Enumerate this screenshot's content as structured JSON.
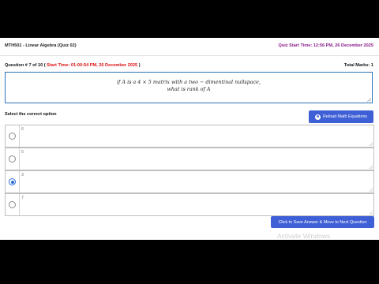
{
  "header": {
    "course": "MTH501 - Linear Algebra (Quiz 02)",
    "quiz_start": "Quiz Start Time: 12:56 PM, 26 December 2025"
  },
  "question": {
    "number_prefix": "Question # 7 of 10 (",
    "start_time": "Start Time: 01:00:54 PM, 26 December 2025",
    "number_suffix": ")",
    "total_marks_label": "Total Marks: 1",
    "text_line1": "if A is a 4 × 5 matrix with a two − dimentinal nullspace,",
    "text_line2": "what is rank of A"
  },
  "options_section": {
    "label": "Select the correct option",
    "reload_button": "Reload Math Equations"
  },
  "options": [
    {
      "text": "6",
      "checked": false
    },
    {
      "text": "5",
      "checked": false
    },
    {
      "text": "3",
      "checked": true
    },
    {
      "text": "7",
      "checked": false
    }
  ],
  "save_button": "Click to Save Answer & Move to Next Question",
  "watermark": "Activate Windows"
}
